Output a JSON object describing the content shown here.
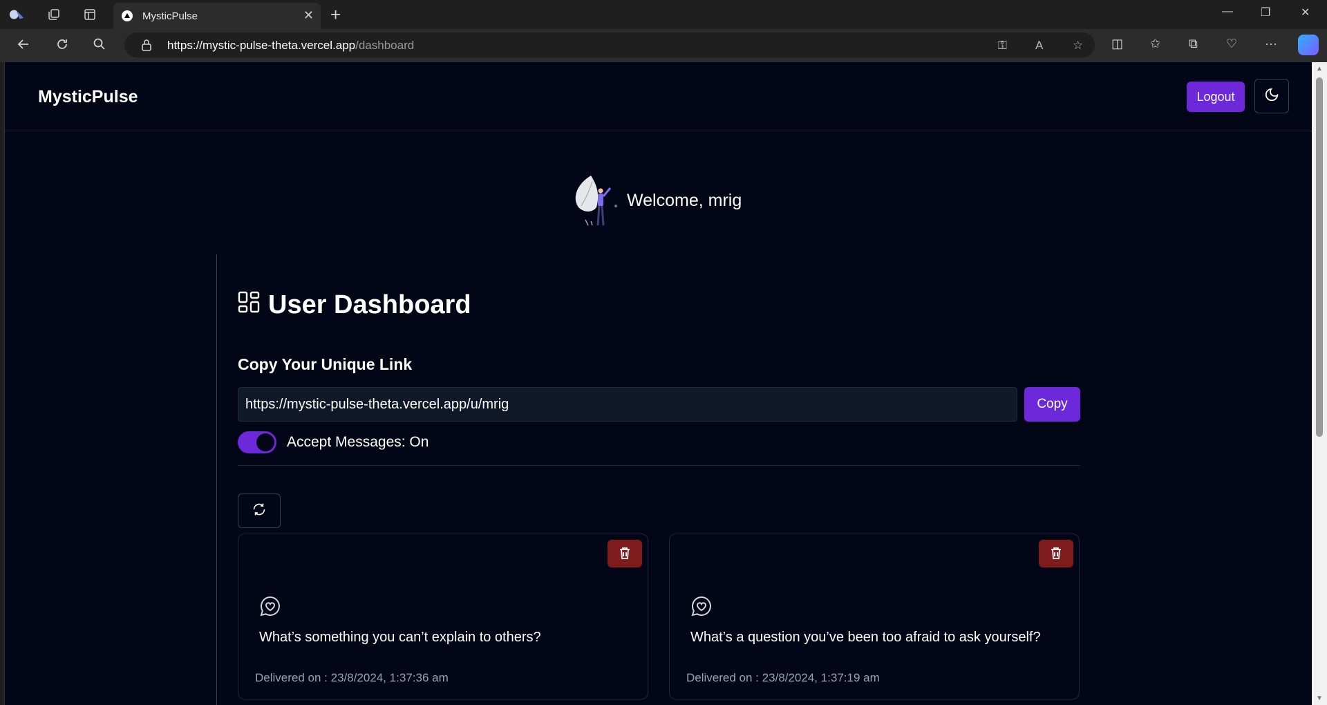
{
  "browser": {
    "tab_title": "MysticPulse",
    "url_host": "https://mystic-pulse-theta.vercel.app",
    "url_path": "/dashboard"
  },
  "navbar": {
    "brand": "MysticPulse",
    "logout_label": "Logout"
  },
  "welcome": {
    "text": "Welcome, mrig"
  },
  "dashboard": {
    "title": "User Dashboard",
    "link_label": "Copy Your Unique Link",
    "link_value": "https://mystic-pulse-theta.vercel.app/u/mrig",
    "copy_label": "Copy",
    "accept_messages_label": "Accept Messages: On",
    "accept_messages_on": true
  },
  "messages": [
    {
      "text": "What’s something you can’t explain to others?",
      "date": "Delivered on : 23/8/2024, 1:37:36 am"
    },
    {
      "text": "What’s a question you’ve been too afraid to ask yourself?",
      "date": "Delivered on : 23/8/2024, 1:37:19 am"
    }
  ],
  "colors": {
    "accent": "#6d28d9",
    "background": "#020617",
    "danger": "#7f1d1d"
  }
}
